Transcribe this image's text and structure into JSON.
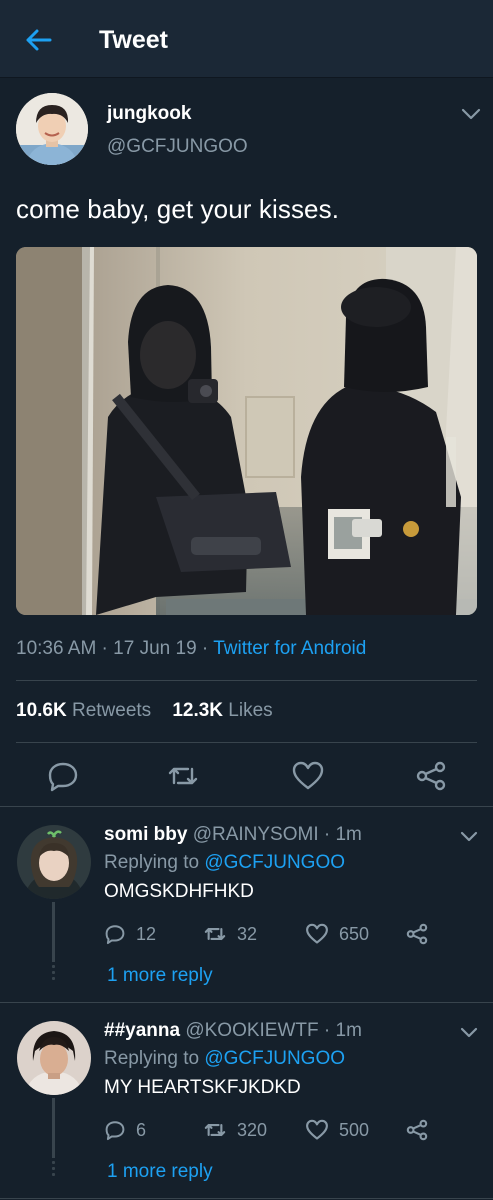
{
  "topbar": {
    "title": "Tweet"
  },
  "tweet": {
    "name": "jungkook",
    "handle": "@GCFJUNGOO",
    "text": "come baby, get your kisses.",
    "time": "10:36 AM",
    "date": "17 Jun 19",
    "separator": " · ",
    "app": "Twitter for Android",
    "retweets_count": "10.6K",
    "retweets_label": "Retweets",
    "likes_count": "12.3K",
    "likes_label": "Likes"
  },
  "replies": [
    {
      "name": "somi bby",
      "handle": "@RAINYSOMI",
      "age": " · 1m",
      "replying_label": "Replying to",
      "replying_to": "@GCFJUNGOO",
      "text": "OMGSKDHFHKD",
      "reply_count": "12",
      "retweet_count": "32",
      "like_count": "650",
      "more": "1 more reply"
    },
    {
      "name": "##yanna",
      "handle": "@KOOKIEWTF",
      "age": " · 1m",
      "replying_label": "Replying to",
      "replying_to": "@GCFJUNGOO",
      "text": "MY HEARTSKFJKDKD",
      "reply_count": "6",
      "retweet_count": "320",
      "like_count": "500",
      "more": "1 more reply"
    }
  ],
  "colors": {
    "background": "#15202b",
    "accent": "#1da1f2",
    "muted": "#8899a6",
    "divider": "#38444d"
  },
  "icons": {
    "back": "arrow-left-icon",
    "caret": "chevron-down-icon",
    "reply": "comment-icon",
    "retweet": "retweet-icon",
    "like": "heart-icon",
    "share": "share-icon"
  }
}
